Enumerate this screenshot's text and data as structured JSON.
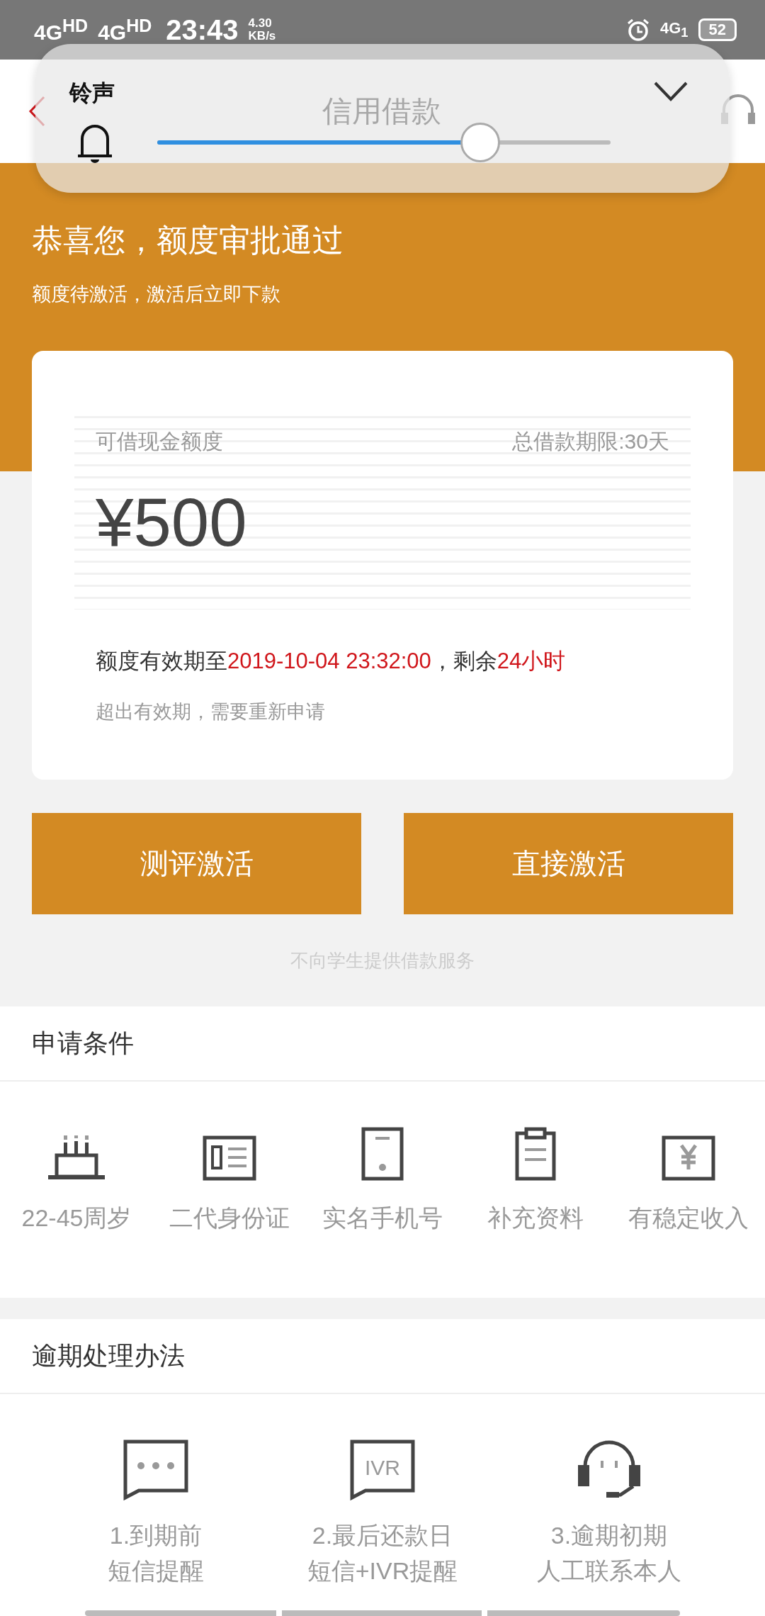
{
  "status_bar": {
    "networks": [
      "4G$^{HD}$",
      "4G$^{HD}$"
    ],
    "time": "23:43",
    "speed": [
      "4.30",
      "KB/s"
    ],
    "network_right": "4G$_{1}$",
    "battery": "52"
  },
  "volume_popup": {
    "label": "铃声",
    "level": 0.71
  },
  "header": {
    "title": "信用借款"
  },
  "banner": {
    "title": "恭喜您，额度审批通过",
    "subtitle": "额度待激活，激活后立即下款"
  },
  "card": {
    "amount_label": "可借现金额度",
    "term": "总借款期限:30天",
    "amount": "¥500",
    "validity": [
      {
        "text": "额度有效期至",
        "highlight": false
      },
      {
        "text": "2019-10-04 23:32:00",
        "highlight": true
      },
      {
        "text": "，剩余",
        "highlight": false
      },
      {
        "text": "24小时",
        "highlight": true
      }
    ],
    "note": "超出有效期，需要重新申请"
  },
  "buttons": [
    "测评激活",
    "直接激活"
  ],
  "notice": "不向学生提供借款服务",
  "conditions": {
    "title": "申请条件",
    "items": [
      "22-45周岁",
      "二代身份证",
      "实名手机号",
      "补充资料",
      "有稳定收入"
    ]
  },
  "overdue": {
    "title": "逾期处理办法",
    "items": [
      {
        "lines": [
          "1.到期前",
          "短信提醒"
        ]
      },
      {
        "lines": [
          "2.最后还款日",
          "短信+IVR提醒"
        ],
        "icon_text": "IVR"
      },
      {
        "lines": [
          "3.逾期初期",
          "人工联系本人"
        ]
      }
    ]
  }
}
